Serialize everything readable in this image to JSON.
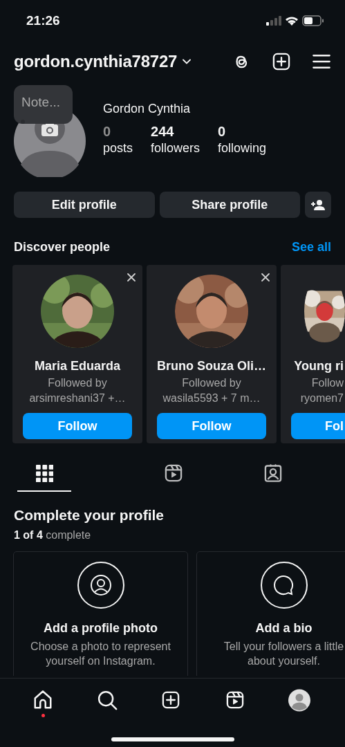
{
  "status_bar": {
    "time": "21:26"
  },
  "header": {
    "username": "gordon.cynthia78727"
  },
  "profile": {
    "note_placeholder": "Note...",
    "display_name": "Gordon Cynthia",
    "stats": [
      {
        "value": "0",
        "label": "posts",
        "dimmed": true
      },
      {
        "value": "244",
        "label": "followers",
        "dimmed": false
      },
      {
        "value": "0",
        "label": "following",
        "dimmed": false
      }
    ]
  },
  "actions": [
    "Edit profile",
    "Share profile"
  ],
  "discover": {
    "title": "Discover people",
    "link": "See all",
    "people": [
      {
        "kind": "card",
        "name": "Maria Eduarda",
        "followed_by": "Followed by",
        "mutuals": "arsimreshani37 +…",
        "button": "Follow"
      },
      {
        "kind": "card",
        "name": "Bruno Souza Oli…",
        "followed_by": "Followed by",
        "mutuals": "wasila5593 + 7 m…",
        "button": "Follow"
      },
      {
        "kind": "partial",
        "name": "Young ri",
        "followed_by": "Follow",
        "mutuals": "ryomen7",
        "button": "Fol"
      }
    ]
  },
  "profile_tabs": [
    {
      "selected": true
    },
    {
      "selected": false
    },
    {
      "selected": false
    }
  ],
  "complete_profile": {
    "title": "Complete your profile",
    "progress": "**1 of 4** complete",
    "tasks": [
      {
        "title": "Add a profile photo",
        "description": "Choose a photo to represent yourself on Instagram."
      },
      {
        "title": "Add a bio",
        "description": "Tell your followers a little about yourself."
      }
    ]
  },
  "bottom_nav": [
    {
      "notification": true
    },
    {
      "notification": false
    },
    {
      "notification": false
    },
    {
      "notification": false
    },
    {
      "notification": false
    }
  ]
}
